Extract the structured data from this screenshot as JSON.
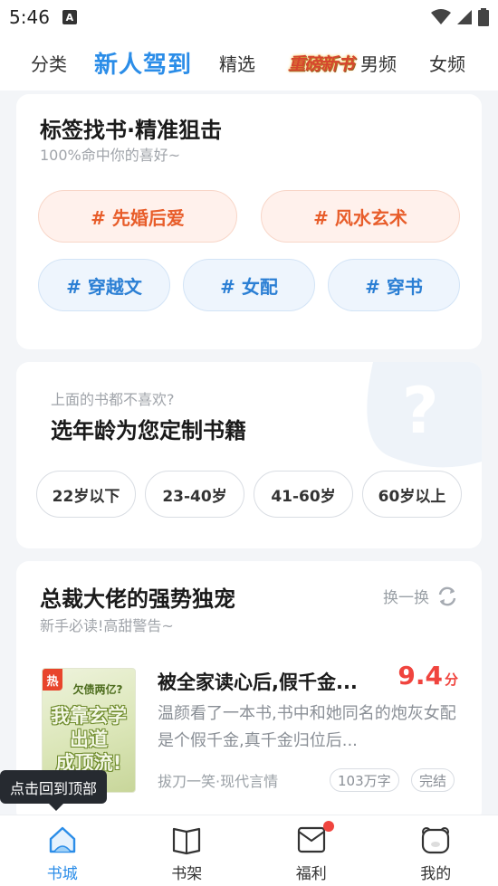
{
  "status_bar": {
    "time": "5:46",
    "notification_glyph": "A"
  },
  "top_nav": {
    "items": [
      "分类",
      "新人驾到",
      "精选",
      "重磅新书",
      "男频",
      "女频"
    ],
    "active_index": 1
  },
  "tags_card": {
    "title": "标签找书·精准狙击",
    "subtitle": "100%命中你的喜好~",
    "tags": [
      "# 先婚后爱",
      "# 风水玄术",
      "# 穿越文",
      "# 女配",
      "# 穿书"
    ]
  },
  "age_card": {
    "question": "上面的书都不喜欢?",
    "title": "选年龄为您定制书籍",
    "options": [
      "22岁以下",
      "23-40岁",
      "41-60岁",
      "60岁以上"
    ]
  },
  "book_card": {
    "title": "总裁大佬的强势独宠",
    "subtitle": "新手必读!高甜警告~",
    "refresh_label": "换一换",
    "book": {
      "badge": "热",
      "cover_lines": [
        "欠债两亿?",
        "我靠玄学",
        "出道",
        "成顶流!"
      ],
      "title": "被全家读心后,假千金...",
      "score": "9.4",
      "score_unit": "分",
      "description": "温颜看了一本书,书中和她同名的炮灰女配是个假千金,真千金归位后...",
      "meta": "拔刀一笑·现代言情",
      "word_count": "103万字",
      "status": "完结"
    }
  },
  "tooltip": {
    "text": "点击回到顶部"
  },
  "tab_bar": {
    "tabs": [
      "书城",
      "书架",
      "福利",
      "我的"
    ],
    "active_index": 0
  },
  "colors": {
    "accent": "#2b8de8",
    "warm_tag": "#e85d2a",
    "cool_tag": "#2b7fd4",
    "score": "#f0443e"
  }
}
